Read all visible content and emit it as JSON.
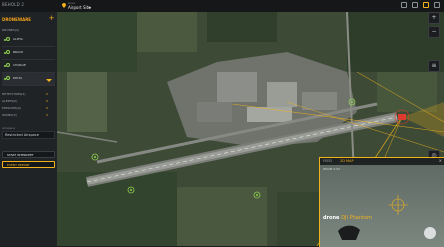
{
  "topbar": {
    "brand": "BEHOLD 2",
    "location_label": "Area",
    "location_value": "Airport Site"
  },
  "sidebar": {
    "title": "DRONEWARE",
    "drones_section": "DRONES(4)",
    "drones": [
      {
        "name": "ALPHA"
      },
      {
        "name": "BRAVO"
      },
      {
        "name": "CHARLIE"
      },
      {
        "name": "DELTA"
      }
    ],
    "stats": [
      {
        "name": "DETECTIONS(2)",
        "value": "2"
      },
      {
        "name": "ALERTS(0)",
        "value": "0"
      },
      {
        "name": "MISSIONS(0)",
        "value": "0"
      },
      {
        "name": "ZONES(3)",
        "value": "3"
      }
    ],
    "airspace_label": "Airspace",
    "airspace_value": "Restricted Airspace",
    "btn_primary": "START INTERCEPT",
    "btn_secondary": "EVENT REPORT"
  },
  "feed": {
    "title": "FEED",
    "mode": "2D MAP",
    "subtitle": "ZOOM 2.5X",
    "label": "drone",
    "label_accent": "DJI Phantom"
  },
  "colors": {
    "accent": "#f2b21b",
    "ok": "#8fd14f",
    "threat": "#e03a2f"
  }
}
